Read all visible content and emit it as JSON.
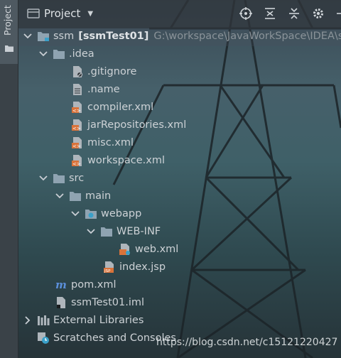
{
  "sidebar": {
    "tab_label": "Project"
  },
  "header": {
    "title": "Project"
  },
  "toolbar": {
    "icons": [
      "locate-icon",
      "expand-all-icon",
      "collapse-all-icon",
      "settings-icon"
    ]
  },
  "tree": {
    "root": {
      "name": "ssm",
      "module": "[ssmTest01]",
      "path": "G:\\workspace\\JavaWorkSpace\\IDEA\\ss"
    },
    "idea": ".idea",
    "gitignore": ".gitignore",
    "name_file": ".name",
    "compiler": "compiler.xml",
    "jarrepo": "jarRepositories.xml",
    "misc": "misc.xml",
    "workspace": "workspace.xml",
    "src": "src",
    "main": "main",
    "webapp": "webapp",
    "webinf": "WEB-INF",
    "webxml": "web.xml",
    "indexjsp": "index.jsp",
    "pom": "pom.xml",
    "iml": "ssmTest01.iml",
    "extlibs": "External Libraries",
    "scratches": "Scratches and Consoles"
  },
  "watermark": "https://blog.csdn.net/c15121220427"
}
